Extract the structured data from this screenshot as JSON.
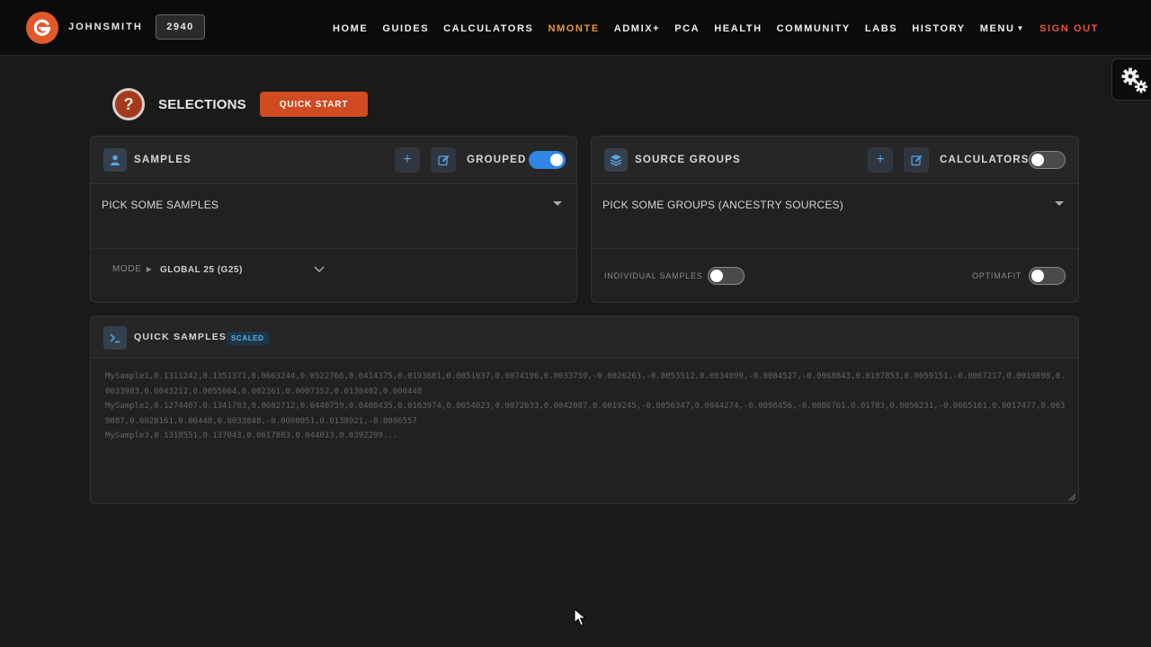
{
  "header": {
    "username": "JOHNSMITH",
    "credits": "2940",
    "nav": [
      {
        "label": "HOME",
        "active": false
      },
      {
        "label": "GUIDES",
        "active": false
      },
      {
        "label": "CALCULATORS",
        "active": false
      },
      {
        "label": "NMONTE",
        "active": true
      },
      {
        "label": "ADMIX+",
        "active": false
      },
      {
        "label": "PCA",
        "active": false
      },
      {
        "label": "HEALTH",
        "active": false
      },
      {
        "label": "COMMUNITY",
        "active": false
      },
      {
        "label": "LABS",
        "active": false
      },
      {
        "label": "HISTORY",
        "active": false
      }
    ],
    "menu_label": "MENU",
    "signout_label": "SIGN OUT"
  },
  "selections": {
    "help_glyph": "?",
    "title": "SELECTIONS",
    "quick_start_label": "QUICK START"
  },
  "samples_panel": {
    "title": "SAMPLES",
    "grouped_label": "GROUPED",
    "grouped_on": true,
    "picker_placeholder": "PICK SOME SAMPLES",
    "mode_label": "MODE",
    "mode_value": "GLOBAL 25 (G25)"
  },
  "sources_panel": {
    "title": "SOURCE GROUPS",
    "calculators_label": "CALCULATORS",
    "calculators_on": false,
    "picker_placeholder": "PICK SOME GROUPS (ANCESTRY SOURCES)",
    "individual_samples_label": "INDIVIDUAL SAMPLES",
    "individual_samples_on": false,
    "optimafit_label": "OPTIMAFIT",
    "optimafit_on": false
  },
  "quick_samples": {
    "title": "QUICK SAMPLES",
    "badge": "SCALED",
    "placeholder": "MySample1,0.1311242,0.1351371,0.0663244,0.0522766,0.0414375,0.0193681,0.0051037,0.0074196,0.0033759,-0.0026263,-0.0053512,0.0034099,-0.0084527,-0.0068843,0.0187853,0.0059151,-0.0067217,0.0019898,0.0033983,0.0043212,0.0055064,0.002361,0.0007352,0.0138402,0.000448\nMySample2,0.1274407,0.1341783,0.0602712,0.0440759,0.0408435,0.0163974,0.0054023,0.0072633,0.0042087,0.0019245,-0.0056347,0.0044274,-0.0098456,-0.0086761,0.01783,0.0056231,-0.0065161,0.0017477,0.0039087,0.0028161,0.00448,0.0033848,-0.0000051,0.0138921,-0.0006557\nMySample3,0.1318551,0.137043,0.0617883,0.044013,0.0392299..."
  },
  "colors": {
    "accent_orange": "#d04a22",
    "active_nav": "#e8963a",
    "signout": "#e8553a",
    "toggle_on": "#2f86e6"
  }
}
